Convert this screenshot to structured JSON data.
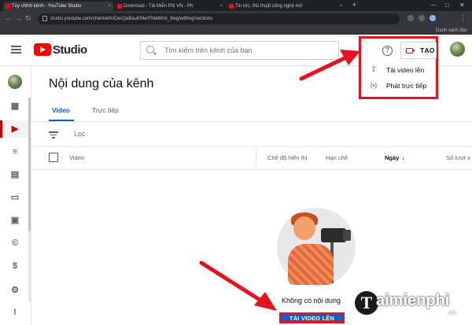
{
  "browser": {
    "tabs": [
      {
        "title": "Tùy chỉnh kênh - YouTube Studio",
        "favicon_color": "#ff0000"
      },
      {
        "title": "Download - Tải Miễn Phí VN - Ph",
        "favicon_color": "#e8121c"
      },
      {
        "title": "Tin tức, thủ thuật công nghệ mớ",
        "favicon_color": "#e8121c"
      }
    ],
    "url": "studio.youtube.com/channel/UCecQaBauKMerFMaWmI_9wg/editing/sections",
    "bookmarks_label": "Danh sách đọc"
  },
  "header": {
    "app_name": "Studio",
    "search_placeholder": "Tìm kiếm trên kênh của bạn",
    "help_glyph": "?",
    "create_label": "TẠO"
  },
  "create_menu": {
    "items": [
      {
        "label": "Tải video lên",
        "icon": "upload-icon"
      },
      {
        "label": "Phát trực tiếp",
        "icon": "live-broadcast-icon"
      }
    ]
  },
  "sidebar": {
    "items": [
      {
        "icon": "dashboard-icon",
        "active": false
      },
      {
        "icon": "content-icon",
        "active": true
      },
      {
        "icon": "playlists-icon",
        "active": false
      },
      {
        "icon": "analytics-icon",
        "active": false
      },
      {
        "icon": "comments-icon",
        "active": false
      },
      {
        "icon": "subtitles-icon",
        "active": false
      },
      {
        "icon": "copyright-icon",
        "active": false
      },
      {
        "icon": "monetization-icon",
        "active": false
      },
      {
        "icon": "settings-icon",
        "active": false
      },
      {
        "icon": "feedback-icon",
        "active": false
      }
    ]
  },
  "main": {
    "title": "Nội dung của kênh",
    "tabs": [
      {
        "label": "Video",
        "active": true
      },
      {
        "label": "Trực tiếp",
        "active": false
      }
    ],
    "filter_placeholder": "Lọc",
    "table_headers": {
      "video": "Video",
      "visibility": "Chế độ hiển thị",
      "restrictions": "Hạn chế",
      "date": "Ngày",
      "date_sort": "↓",
      "views": "Số lượt x"
    },
    "empty_state": {
      "text": "Không có nội dung",
      "button_label": "TẢI VIDEO LÊN"
    }
  },
  "watermark": {
    "initial": "T",
    "name": "aimienphi",
    "domain": ".vn"
  },
  "colors": {
    "youtube_red": "#ff0000",
    "highlight_red": "#e8121c",
    "link_blue": "#065fd4"
  }
}
